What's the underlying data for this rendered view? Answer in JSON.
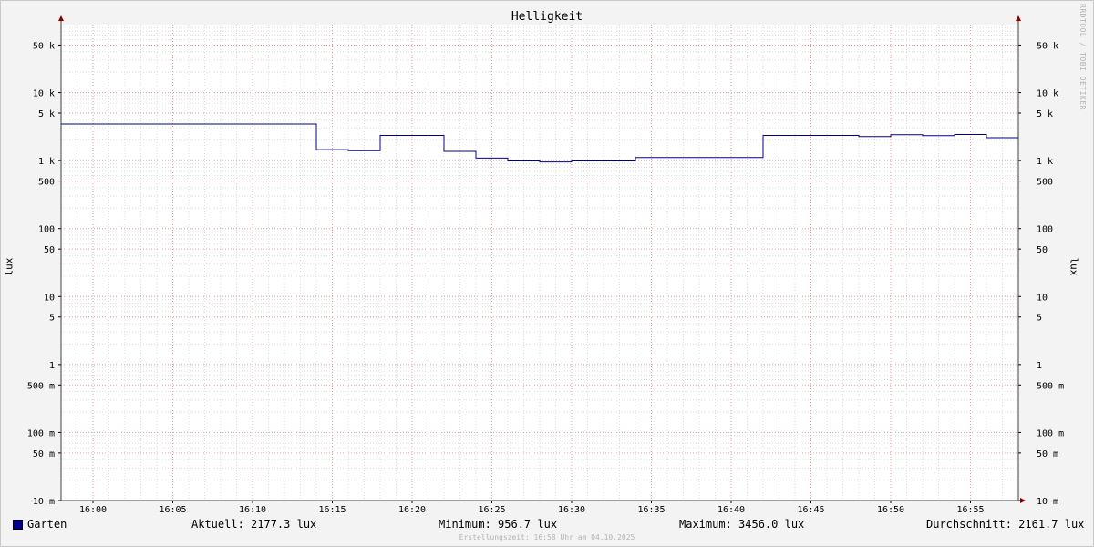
{
  "chart_data": {
    "type": "line",
    "title": "Helligkeit",
    "ylabel": "lux",
    "y_scale": "log",
    "ylim": [
      0.01,
      100000
    ],
    "xlim": [
      "15:58",
      "16:58"
    ],
    "x_tick_labels": [
      "16:00",
      "16:05",
      "16:10",
      "16:15",
      "16:20",
      "16:25",
      "16:30",
      "16:35",
      "16:40",
      "16:45",
      "16:50",
      "16:55"
    ],
    "y_tick_labels": [
      {
        "value": 50000,
        "label": "50 k"
      },
      {
        "value": 10000,
        "label": "10 k"
      },
      {
        "value": 5000,
        "label": "5 k"
      },
      {
        "value": 1000,
        "label": "1 k"
      },
      {
        "value": 500,
        "label": "500"
      },
      {
        "value": 100,
        "label": "100"
      },
      {
        "value": 50,
        "label": "50"
      },
      {
        "value": 10,
        "label": "10"
      },
      {
        "value": 5,
        "label": "5"
      },
      {
        "value": 1,
        "label": "1"
      },
      {
        "value": 0.5,
        "label": "500 m"
      },
      {
        "value": 0.1,
        "label": "100 m"
      },
      {
        "value": 0.05,
        "label": "50 m"
      },
      {
        "value": 0.01,
        "label": "10 m"
      }
    ],
    "grid": true,
    "series": [
      {
        "name": "Garten",
        "color": "#00008b",
        "step": true,
        "points": [
          {
            "t": "15:58",
            "v": 3456
          },
          {
            "t": "16:14",
            "v": 1450
          },
          {
            "t": "16:16",
            "v": 1400
          },
          {
            "t": "16:18",
            "v": 2350
          },
          {
            "t": "16:22",
            "v": 1370
          },
          {
            "t": "16:24",
            "v": 1090
          },
          {
            "t": "16:26",
            "v": 990
          },
          {
            "t": "16:28",
            "v": 957
          },
          {
            "t": "16:30",
            "v": 990
          },
          {
            "t": "16:34",
            "v": 1110
          },
          {
            "t": "16:42",
            "v": 2350
          },
          {
            "t": "16:48",
            "v": 2260
          },
          {
            "t": "16:50",
            "v": 2400
          },
          {
            "t": "16:52",
            "v": 2330
          },
          {
            "t": "16:54",
            "v": 2420
          },
          {
            "t": "16:56",
            "v": 2177.3
          },
          {
            "t": "16:58",
            "v": 2177.3
          }
        ]
      }
    ]
  },
  "legend": {
    "series_name": "Garten",
    "aktuell": "Aktuell: 2177.3 lux",
    "minimum": "Minimum: 956.7 lux",
    "maximum": "Maximum: 3456.0 lux",
    "durchschnitt": "Durchschnitt: 2161.7 lux"
  },
  "watermark": "RRDTOOL / TOBI OETIKER",
  "footer": "Erstellungszeit: 16:58 Uhr am 04.10.2025"
}
